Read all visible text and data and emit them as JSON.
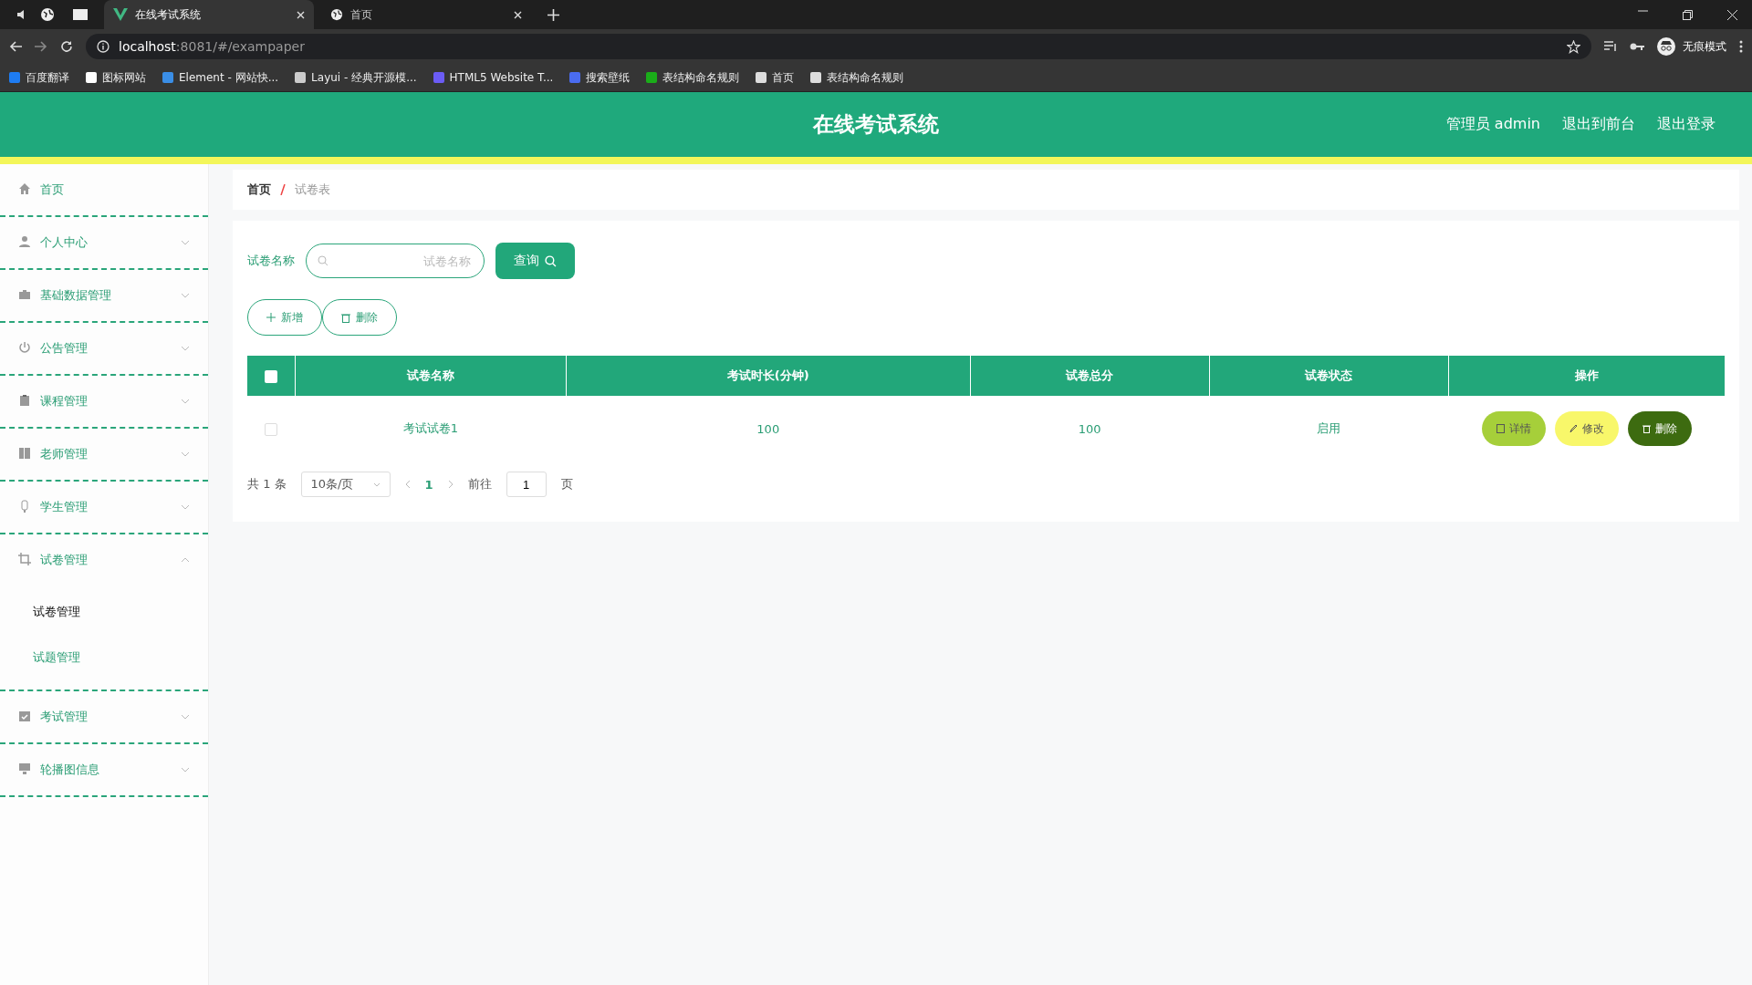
{
  "browser": {
    "tabs": [
      {
        "title": "在线考试系统",
        "selected": true
      },
      {
        "title": "首页",
        "selected": false
      }
    ],
    "url": {
      "host": "localhost",
      "path": ":8081/#/exampaper"
    },
    "bookmarks": [
      "百度翻译",
      "图标网站",
      "Element - 网站快...",
      "Layui - 经典开源模...",
      "HTML5 Website T...",
      "搜索壁纸",
      "表结构命名规则",
      "首页",
      "表结构命名规则"
    ],
    "profile_label": "无痕模式"
  },
  "header": {
    "title": "在线考试系统",
    "links": [
      "管理员 admin",
      "退出到前台",
      "退出登录"
    ]
  },
  "sidebar": {
    "items": [
      {
        "label": "首页",
        "kind": "link"
      },
      {
        "label": "个人中心",
        "kind": "group",
        "expanded": false
      },
      {
        "label": "基础数据管理",
        "kind": "group",
        "expanded": false
      },
      {
        "label": "公告管理",
        "kind": "group",
        "expanded": false
      },
      {
        "label": "课程管理",
        "kind": "group",
        "expanded": false
      },
      {
        "label": "老师管理",
        "kind": "group",
        "expanded": false
      },
      {
        "label": "学生管理",
        "kind": "group",
        "expanded": false
      },
      {
        "label": "试卷管理",
        "kind": "group",
        "expanded": true,
        "children": [
          {
            "label": "试卷管理",
            "selected": true
          },
          {
            "label": "试题管理",
            "selected": false
          }
        ]
      },
      {
        "label": "考试管理",
        "kind": "group",
        "expanded": false
      },
      {
        "label": "轮播图信息",
        "kind": "group",
        "expanded": false
      }
    ]
  },
  "breadcrumb": [
    "首页",
    "试卷表"
  ],
  "search": {
    "label": "试卷名称",
    "placeholder": "试卷名称",
    "button": "查询"
  },
  "actions": [
    "新增",
    "删除"
  ],
  "table": {
    "all_checked": false,
    "columns": [
      "试卷名称",
      "考试时长(分钟)",
      "试卷总分",
      "试卷状态",
      "操作"
    ],
    "rows": [
      {
        "checked": false,
        "cells": [
          "考试试卷1",
          "100",
          "100",
          "启用"
        ],
        "buttons": [
          {
            "label": "详情",
            "kind": "detail"
          },
          {
            "label": "修改",
            "kind": "edit"
          },
          {
            "label": "删除",
            "kind": "delete"
          }
        ]
      }
    ]
  },
  "pagination": {
    "total": "共 1 条",
    "page_size": "10条/页",
    "pages": [
      {
        "label": "1",
        "selected": true
      }
    ],
    "goto_label": "前往",
    "goto_value": "1",
    "suffix": "页"
  }
}
